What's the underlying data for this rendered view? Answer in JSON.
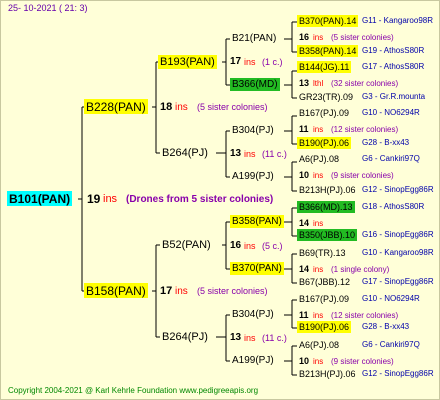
{
  "header": {
    "date": "25- 10-2021 ( 21: 3)"
  },
  "footer": {
    "text": "Copyright 2004-2021 @ Karl Kehrle Foundation   www.pedigreeapis.org"
  },
  "colors": {
    "yellow": "#ffff00",
    "green": "#22bb22",
    "cyan": "#00ffff",
    "red": "#ff0000",
    "blue": "#0000aa",
    "purple": "#8800aa",
    "footer": "#008800",
    "date": "#6600aa"
  },
  "root": {
    "name": "B101(PAN)",
    "ins": "19",
    "ins_word": "ins",
    "note": "(Drones from 5 sister colonies)"
  },
  "gen1": [
    {
      "name": "B228(PAN)",
      "ins": "18",
      "ins_word": "ins",
      "note": "(5 sister colonies)"
    },
    {
      "name": "B158(PAN)",
      "ins": "17",
      "ins_word": "ins",
      "note": "(5 sister colonies)"
    }
  ],
  "gen2": [
    {
      "name": "B193(PAN)",
      "ins": "17",
      "ins_word": "ins",
      "note": "(1 c.)"
    },
    {
      "name": "B264(PJ)",
      "ins": "13",
      "ins_word": "ins",
      "note": "(11 c.)"
    },
    {
      "name": "B52(PAN)",
      "ins": "16",
      "ins_word": "ins",
      "note": "(5 c.)"
    },
    {
      "name": "B264(PJ)",
      "ins": "13",
      "ins_word": "ins",
      "note": "(11 c.)"
    }
  ],
  "gen3": [
    {
      "name": "B21(PAN)"
    },
    {
      "name": "B366(MD)"
    },
    {
      "name": "B304(PJ)"
    },
    {
      "name": "A199(PJ)"
    },
    {
      "name": "B358(PAN)"
    },
    {
      "name": "B370(PAN)"
    },
    {
      "name": "B304(PJ)"
    },
    {
      "name": "A199(PJ)"
    }
  ],
  "gen4": [
    {
      "name": "B370(PAN).14",
      "ref": "G11 - Kangaroo98R",
      "ins": "16",
      "ins_word": "ins",
      "note": "(5 sister colonies)"
    },
    {
      "name": "B358(PAN).14",
      "ref": "G19 - AthosS80R"
    },
    {
      "name": "B144(JG).11",
      "ref": "G17 - AthosS80R",
      "ins": "13",
      "ins_word": "lthl",
      "note": "(32 sister colonies)"
    },
    {
      "name": "GR23(TR).09",
      "ref": "G3 - Gr.R.mounta"
    },
    {
      "name": "B167(PJ).09",
      "ref": "G10 - NO6294R",
      "ins": "11",
      "ins_word": "ins",
      "note": "(12 sister colonies)"
    },
    {
      "name": "B190(PJ).06",
      "ref": "G28 - B-xx43"
    },
    {
      "name": "A6(PJ).08",
      "ref": "G6 - Cankiri97Q",
      "ins": "10",
      "ins_word": "ins",
      "note": "(9 sister colonies)"
    },
    {
      "name": "B213H(PJ).06",
      "ref": "G12 - SinopEgg86R"
    },
    {
      "name": "B366(MD).13",
      "ref": "G18 - AthosS80R",
      "ins": "14",
      "ins_word": "ins",
      "note": ""
    },
    {
      "name": "B350(JBB).10",
      "ref": "G16 - SinopEgg86R"
    },
    {
      "name": "B69(TR).13",
      "ref": "G10 - Kangaroo98R",
      "ins": "14",
      "ins_word": "ins",
      "note": "(1 single colony)"
    },
    {
      "name": "B67(JBB).12",
      "ref": "G17 - SinopEgg86R"
    },
    {
      "name": "B167(PJ).09",
      "ref": "G10 - NO6294R",
      "ins": "11",
      "ins_word": "ins",
      "note": "(12 sister colonies)"
    },
    {
      "name": "B190(PJ).06",
      "ref": "G28 - B-xx43"
    },
    {
      "name": "A6(PJ).08",
      "ref": "G6 - Cankiri97Q",
      "ins": "10",
      "ins_word": "ins",
      "note": "(9 sister colonies)"
    },
    {
      "name": "B213H(PJ).06",
      "ref": "G12 - SinopEgg86R"
    }
  ]
}
